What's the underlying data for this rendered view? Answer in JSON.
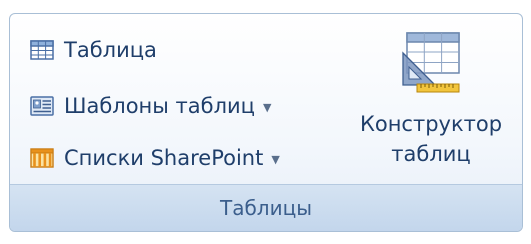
{
  "group": {
    "title": "Таблицы"
  },
  "buttons": {
    "table": {
      "label": "Таблица",
      "icon": "table-grid-icon"
    },
    "table_templates": {
      "label": "Шаблоны таблиц",
      "icon": "table-template-icon",
      "arrow": "▼"
    },
    "sharepoint_lists": {
      "label": "Списки SharePoint",
      "icon": "sharepoint-list-icon",
      "arrow": "▼"
    },
    "table_designer": {
      "line1": "Конструктор",
      "line2": "таблиц",
      "icon": "table-designer-icon"
    }
  },
  "colors": {
    "label_text": "#1f3e6a",
    "group_border": "#a9bfd6",
    "footer_bg": "#c3d6ec",
    "footer_text": "#3b5e8c"
  }
}
